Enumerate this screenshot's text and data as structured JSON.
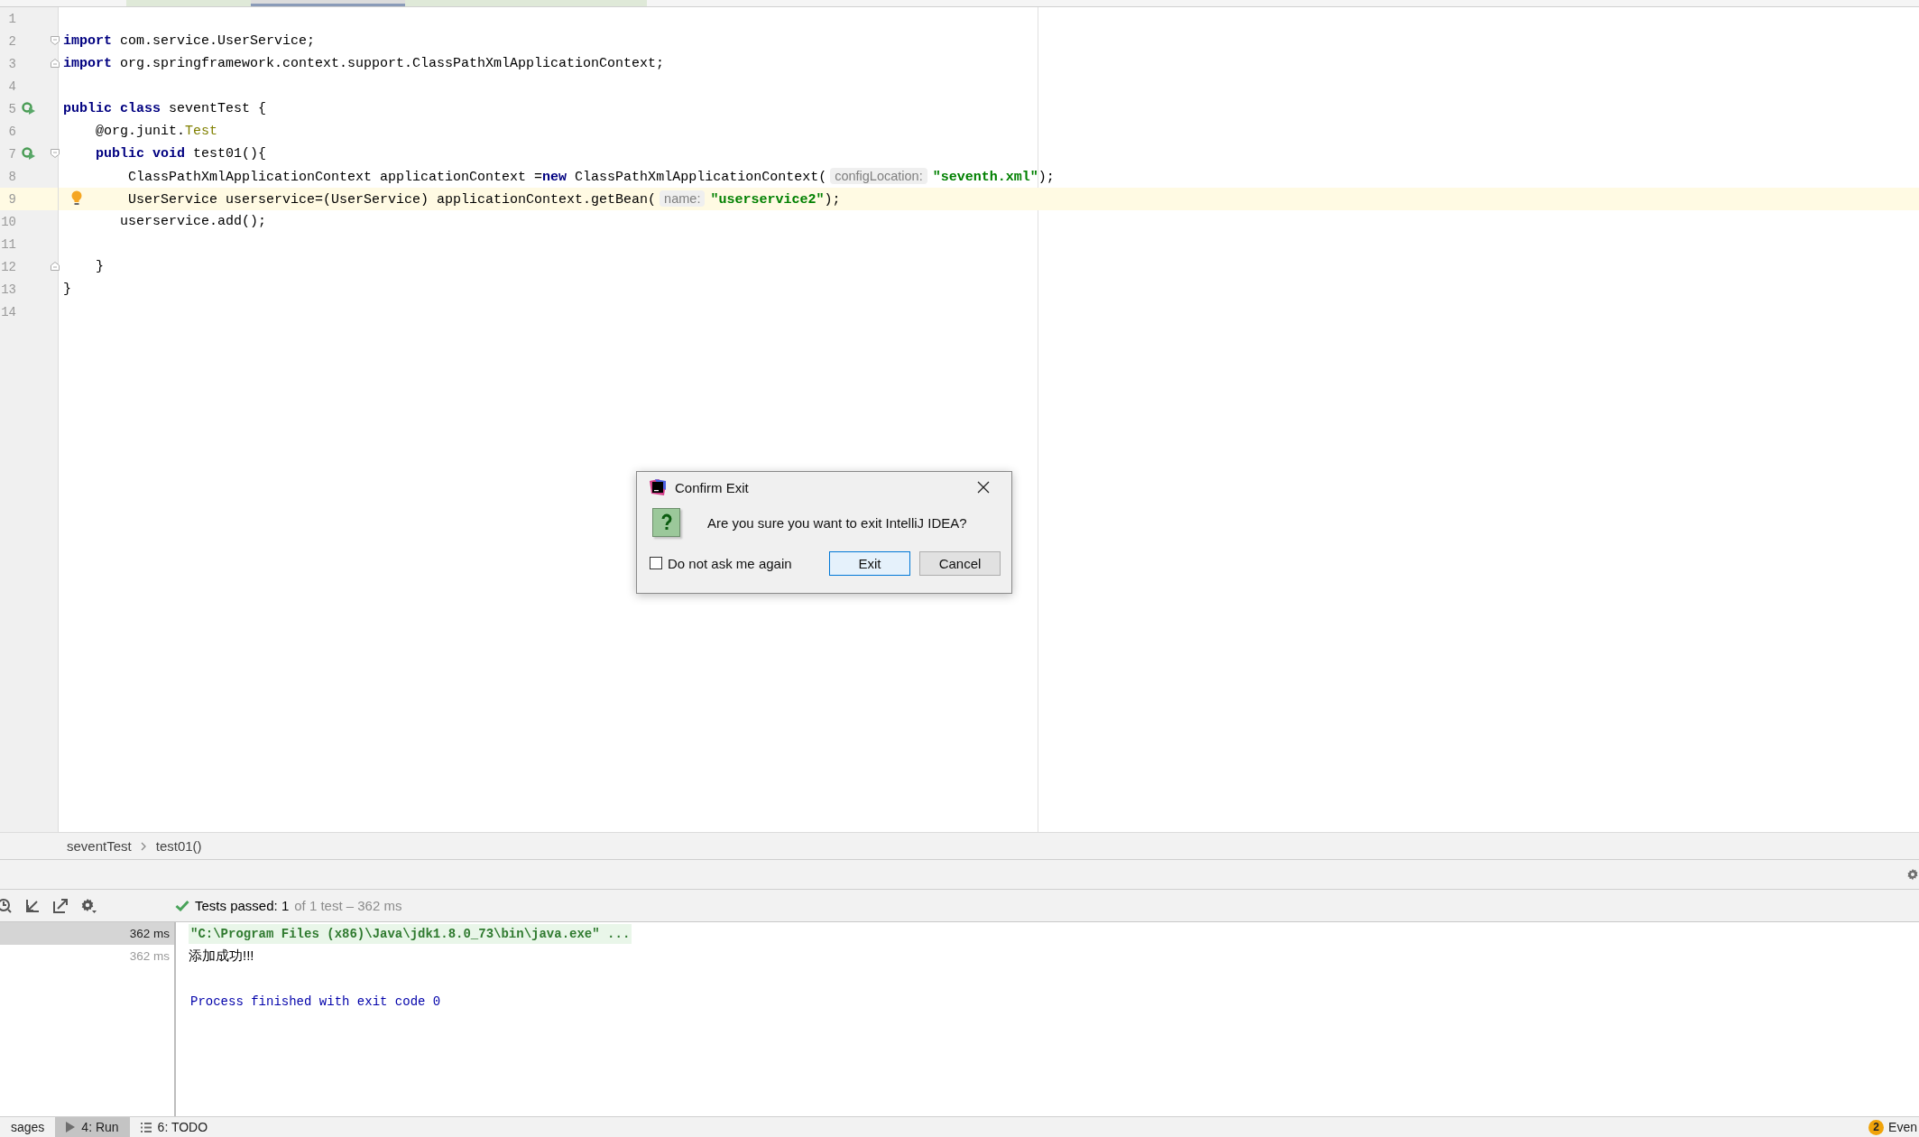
{
  "editor_tabs": [
    {
      "selected": false
    },
    {
      "selected": true
    },
    {
      "selected": false
    }
  ],
  "editor": {
    "lines": [
      {
        "number": "1",
        "current": false,
        "run_marker": false,
        "bulb": false,
        "fold_start": false,
        "fold_end": false
      },
      {
        "number": "2",
        "current": false,
        "run_marker": false,
        "bulb": false,
        "fold_start": true,
        "fold_end": false,
        "tokens": [
          {
            "kind": "keyword",
            "text": "import"
          },
          {
            "kind": "plain",
            "text": " com.service.UserService;"
          }
        ]
      },
      {
        "number": "3",
        "current": false,
        "run_marker": false,
        "bulb": false,
        "fold_start": false,
        "fold_end": true,
        "tokens": [
          {
            "kind": "keyword",
            "text": "import"
          },
          {
            "kind": "plain",
            "text": " org.springframework.context.support.ClassPathXmlApplicationContext;"
          }
        ]
      },
      {
        "number": "4",
        "current": false,
        "run_marker": false,
        "bulb": false,
        "fold_start": false,
        "fold_end": false
      },
      {
        "number": "5",
        "current": false,
        "run_marker": true,
        "bulb": false,
        "fold_start": false,
        "fold_end": false,
        "tokens": [
          {
            "kind": "keyword",
            "text": "public class"
          },
          {
            "kind": "plain",
            "text": " seventTest {"
          }
        ]
      },
      {
        "number": "6",
        "current": false,
        "run_marker": false,
        "bulb": false,
        "fold_start": false,
        "fold_end": false,
        "tokens": [
          {
            "kind": "plain",
            "text": "    @org.junit."
          },
          {
            "kind": "annotation",
            "text": "Test"
          }
        ]
      },
      {
        "number": "7",
        "current": false,
        "run_marker": true,
        "bulb": false,
        "fold_start": true,
        "fold_end": false,
        "tokens": [
          {
            "kind": "keyword",
            "text": "    public void"
          },
          {
            "kind": "plain",
            "text": " test01(){"
          }
        ]
      },
      {
        "number": "8",
        "current": false,
        "run_marker": false,
        "bulb": false,
        "fold_start": false,
        "fold_end": false,
        "tokens": [
          {
            "kind": "plain",
            "text": "        ClassPathXmlApplicationContext applicationContext ="
          },
          {
            "kind": "keyword",
            "text": "new"
          },
          {
            "kind": "plain",
            "text": " ClassPathXmlApplicationContext("
          },
          {
            "kind": "hint",
            "text": "configLocation:"
          },
          {
            "kind": "string",
            "text": "\"seventh.xml\""
          },
          {
            "kind": "plain",
            "text": ");"
          }
        ]
      },
      {
        "number": "9",
        "current": true,
        "run_marker": false,
        "bulb": true,
        "fold_start": false,
        "fold_end": false,
        "tokens": [
          {
            "kind": "plain",
            "text": "        UserService userservice=(UserService) applicationContext.getBean("
          },
          {
            "kind": "hint",
            "text": "name:"
          },
          {
            "kind": "string",
            "text": "\"userservice2\""
          },
          {
            "kind": "plain",
            "text": ");"
          }
        ]
      },
      {
        "number": "10",
        "current": false,
        "run_marker": false,
        "bulb": false,
        "fold_start": false,
        "fold_end": false,
        "tokens": [
          {
            "kind": "plain",
            "text": "       userservice.add();"
          }
        ]
      },
      {
        "number": "11",
        "current": false,
        "run_marker": false,
        "bulb": false,
        "fold_start": false,
        "fold_end": false
      },
      {
        "number": "12",
        "current": false,
        "run_marker": false,
        "bulb": false,
        "fold_start": false,
        "fold_end": true,
        "tokens": [
          {
            "kind": "plain",
            "text": "    }"
          }
        ]
      },
      {
        "number": "13",
        "current": false,
        "run_marker": false,
        "bulb": false,
        "fold_start": false,
        "fold_end": false,
        "tokens": [
          {
            "kind": "plain",
            "text": "}"
          }
        ]
      },
      {
        "number": "14",
        "current": false,
        "run_marker": false,
        "bulb": false,
        "fold_start": false,
        "fold_end": false
      }
    ]
  },
  "breadcrumbs": [
    "seventTest",
    "test01()"
  ],
  "run_panel": {
    "test_summary": "Tests passed: 1",
    "test_detail": "of 1 test – 362 ms",
    "tree": [
      {
        "time": "362 ms",
        "selected": true
      },
      {
        "time": "362 ms",
        "selected": false
      }
    ],
    "console": [
      {
        "kind": "command",
        "text": "\"C:\\Program Files (x86)\\Java\\jdk1.8.0_73\\bin\\java.exe\" ..."
      },
      {
        "kind": "output",
        "text": "添加成功!!!"
      },
      {
        "kind": "blank"
      },
      {
        "kind": "exit",
        "text": "Process finished with exit code 0"
      }
    ]
  },
  "status_bar": {
    "tabs": [
      {
        "label": "sages",
        "selected": false,
        "kind": "text"
      },
      {
        "label": "4: Run",
        "selected": true,
        "kind": "run"
      },
      {
        "label": "6: TODO",
        "selected": false,
        "kind": "todo"
      }
    ],
    "event_count": "2",
    "event_label": "Even"
  },
  "dialog": {
    "title": "Confirm Exit",
    "message": "Are you sure you want to exit IntelliJ IDEA?",
    "checkbox": {
      "label": "Do not ask me again",
      "checked": false
    },
    "buttons": [
      {
        "label": "Exit",
        "default": true
      },
      {
        "label": "Cancel",
        "default": false
      }
    ]
  }
}
